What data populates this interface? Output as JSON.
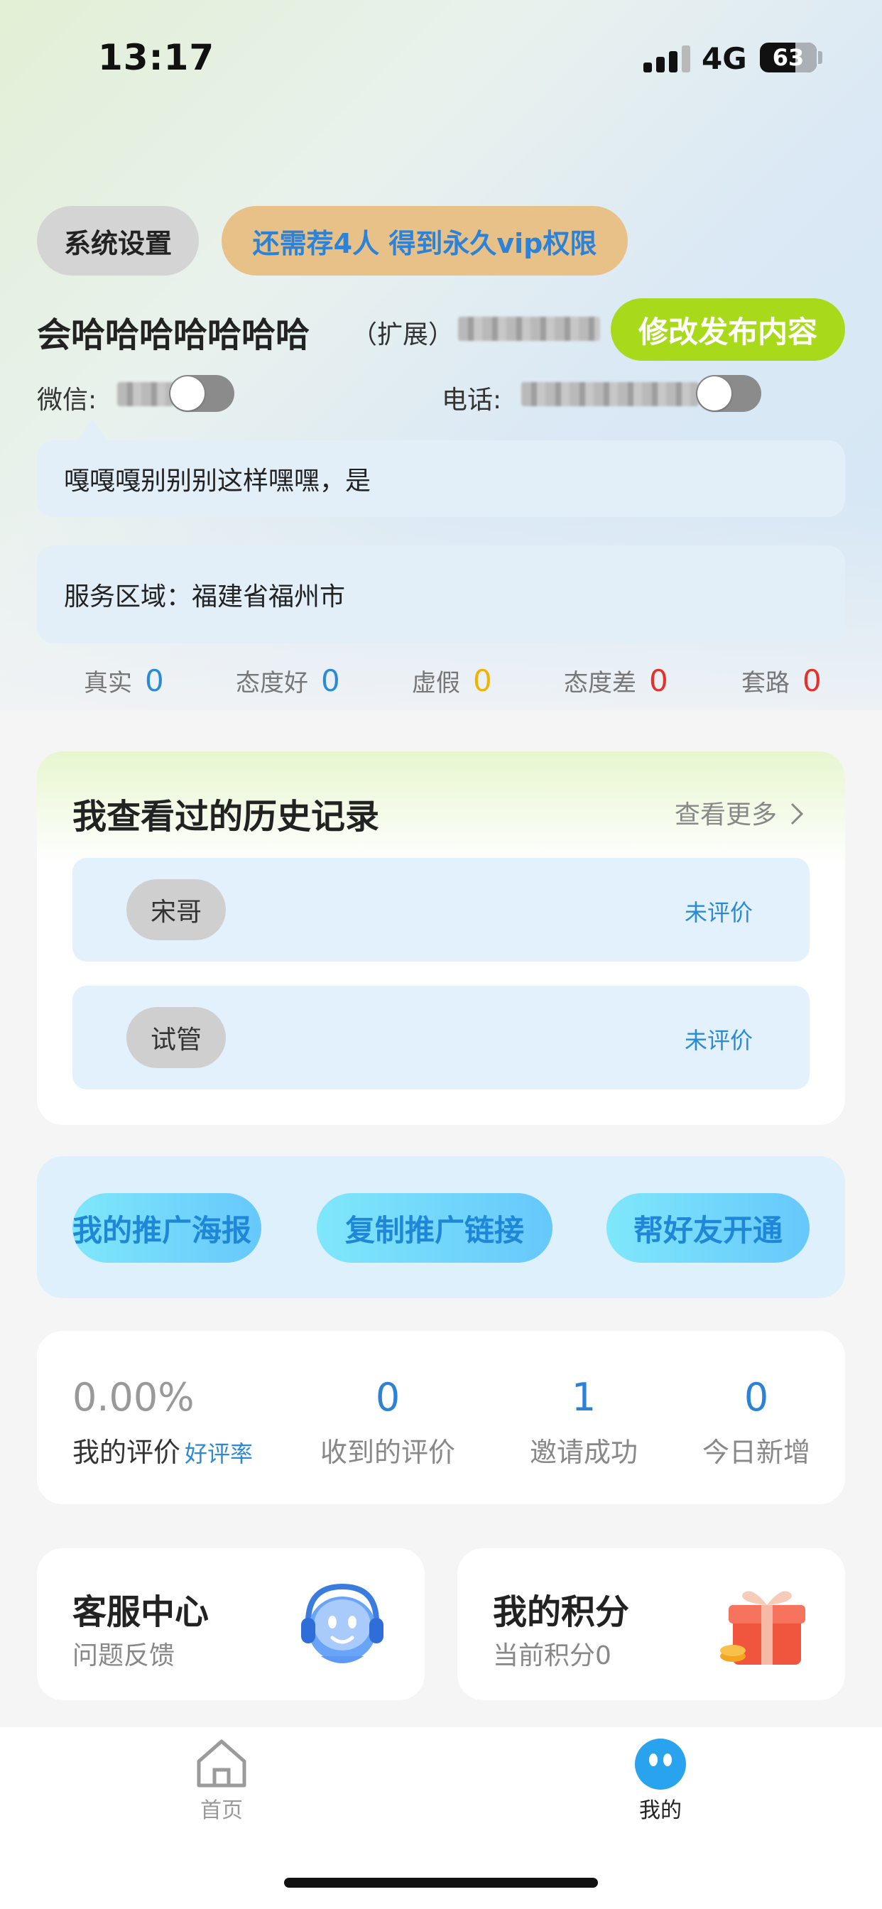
{
  "status_bar": {
    "time": "13:17",
    "network": "4G",
    "battery": "63"
  },
  "header": {
    "settings_label": "系统设置",
    "vip_label": "还需荐4人 得到永久vip权限",
    "user_name": "会哈哈哈哈哈哈哈",
    "extension_label": "（扩展）",
    "edit_label": "修改发布内容",
    "wechat_label": "微信:",
    "phone_label": "电话:"
  },
  "bio": "嘎嘎嘎别别别这样嘿嘿，是",
  "service_area": "服务区域：福建省福州市",
  "ratings": [
    {
      "label": "真实",
      "value": "0",
      "color": "#2b8ad6"
    },
    {
      "label": "态度好",
      "value": "0",
      "color": "#2b8ad6"
    },
    {
      "label": "虚假",
      "value": "0",
      "color": "#f0b400"
    },
    {
      "label": "态度差",
      "value": "0",
      "color": "#e8302a"
    },
    {
      "label": "套路",
      "value": "0",
      "color": "#e8302a"
    }
  ],
  "history": {
    "title": "我查看过的历史记录",
    "more_label": "查看更多",
    "items": [
      {
        "name": "宋哥",
        "status": "未评价"
      },
      {
        "name": "试管",
        "status": "未评价"
      }
    ]
  },
  "promo": {
    "poster_label": "我的推广海报",
    "copy_link_label": "复制推广链接",
    "help_friend_label": "帮好友开通"
  },
  "stats": {
    "rating_value": "0.00%",
    "rating_label": "我的评价",
    "rating_sub": "好评率",
    "received_value": "0",
    "received_label": "收到的评价",
    "invited_value": "1",
    "invited_label": "邀请成功",
    "today_value": "0",
    "today_label": "今日新增"
  },
  "service_center": {
    "title": "客服中心",
    "subtitle": "问题反馈",
    "icon": "customer-service-robot-icon"
  },
  "points": {
    "title": "我的积分",
    "subtitle": "当前积分0",
    "icon": "gift-box-icon"
  },
  "tabbar": {
    "home_label": "首页",
    "mine_label": "我的",
    "active_color": "#2aa3ee"
  }
}
